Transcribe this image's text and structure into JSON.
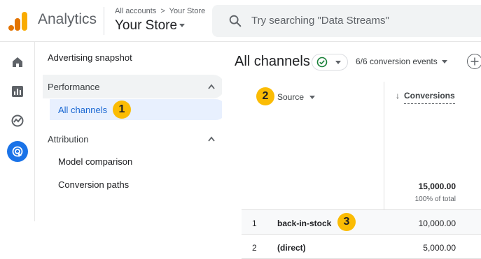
{
  "header": {
    "app_name": "Analytics",
    "breadcrumb": {
      "accounts": "All accounts",
      "separator": ">",
      "property": "Your Store"
    },
    "account_name": "Your Store",
    "search_placeholder": "Try searching \"Data Streams\""
  },
  "rail": {
    "items": [
      "home-icon",
      "reports-icon",
      "explore-icon",
      "advertising-icon"
    ],
    "active": "advertising-icon"
  },
  "sidenav": {
    "advertising_snapshot": "Advertising snapshot",
    "performance": {
      "label": "Performance",
      "items": [
        "All channels"
      ]
    },
    "attribution": {
      "label": "Attribution",
      "items": [
        "Model comparison",
        "Conversion paths"
      ]
    }
  },
  "badges": [
    "1",
    "2",
    "3"
  ],
  "main": {
    "title": "All channels",
    "conversion_events": "6/6 conversion events"
  },
  "table": {
    "headers": {
      "source": "Source",
      "conversions": "Conversions"
    },
    "total": {
      "value": "15,000.00",
      "sub": "100% of total"
    },
    "rows": [
      {
        "index": "1",
        "source": "back-in-stock",
        "conversions": "10,000.00"
      },
      {
        "index": "2",
        "source": "(direct)",
        "conversions": "5,000.00"
      }
    ]
  },
  "colors": {
    "accent": "#1a73e8",
    "badge": "#fbbc04",
    "active_nav_bg": "#e8f0fe",
    "active_nav_text": "#1967d2",
    "check": "#188038"
  }
}
